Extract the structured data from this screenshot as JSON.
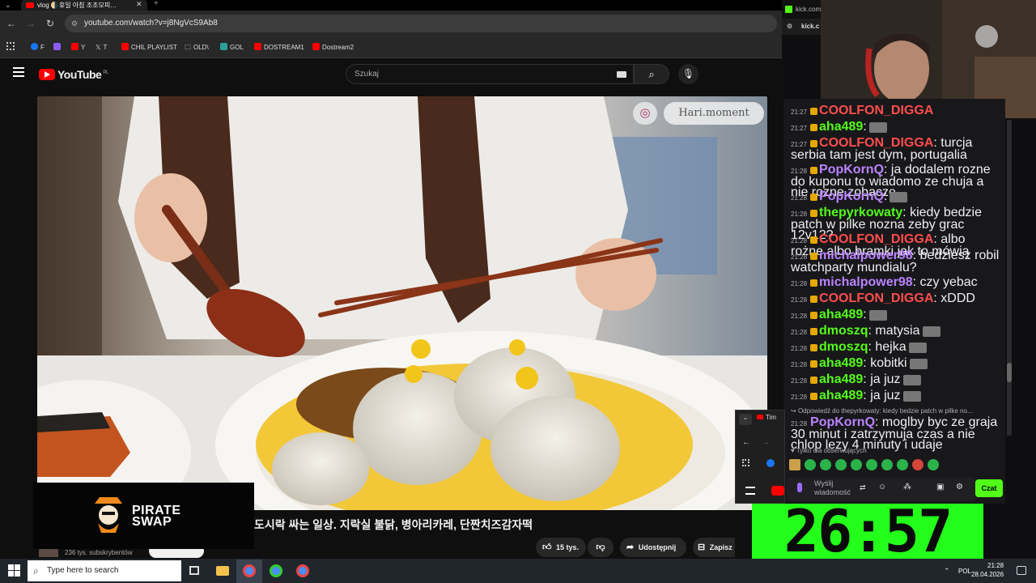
{
  "browser": {
    "tab_title": "vlog 🌗휴일 아침 조조모피…",
    "url": "youtube.com/watch?v=j8NgVcS9Ab8",
    "bookmarks": [
      {
        "label": "F",
        "color": "#1877f2"
      },
      {
        "label": "",
        "color": "#8b5cf6"
      },
      {
        "label": "Y",
        "color": "#ff0000"
      },
      {
        "label": "T",
        "color": "#ffffff"
      },
      {
        "label": "CHIL PLAYLIST",
        "color": "#ff0000"
      },
      {
        "label": "OLD\\",
        "color": "#cccccc"
      },
      {
        "label": "GOL",
        "color": "#2aa198"
      },
      {
        "label": "DOSTREAM1",
        "color": "#ff0000"
      },
      {
        "label": "Dostream2",
        "color": "#ff0000"
      }
    ]
  },
  "youtube": {
    "logo_text": "YouTube",
    "country": "PL",
    "search_placeholder": "Szukaj",
    "video_watermark": "Hari.moment",
    "video_title": "도시락 싸는 일상. 지락실 불닭, 병아리카레, 단짠치즈감자떡",
    "subscribers": "236 tys. subskrybentów",
    "likes": "15 tys.",
    "share_label": "Udostępnij",
    "save_label": "Zapisz",
    "sponsor_text_1": "PIRATE",
    "sponsor_text_2": "SWAP"
  },
  "kick": {
    "tab_title": "kick.com",
    "url": "kick.c"
  },
  "chat": {
    "messages": [
      {
        "time": "21:27",
        "user": "COOLFON_DIGGA",
        "color": "#ff4d4d",
        "text": ""
      },
      {
        "time": "21:27",
        "user": "aha489",
        "color": "#53fc18",
        "text": ":",
        "emote": true
      },
      {
        "time": "21:27",
        "user": "COOLFON_DIGGA",
        "color": "#ff4d4d",
        "text": ": turcja serbia tam jest dym, portugalia"
      },
      {
        "time": "21:28",
        "user": "PopKornQ",
        "color": "#b983ff",
        "text": ": ja dodalem rozne do kuponu to wiadomo ze chuja a nie rozne zobacze"
      },
      {
        "time": "21:28",
        "user": "PopKornQ",
        "color": "#b983ff",
        "text": ":",
        "emote": true
      },
      {
        "time": "21:28",
        "user": "thepyrkowaty",
        "color": "#53fc18",
        "text": ": kiedy bedzie patch w pilke nozna zeby grac 12v12?"
      },
      {
        "time": "21:28",
        "user": "COOLFON_DIGGA",
        "color": "#ff4d4d",
        "text": ": albo rożne albo bramki jak to mówią"
      },
      {
        "time": "21:28",
        "user": "michalpower98",
        "color": "#b983ff",
        "text": ": bedziesz robil watchparty mundialu?"
      },
      {
        "time": "21:28",
        "user": "michalpower98",
        "color": "#b983ff",
        "text": ": czy yebac"
      },
      {
        "time": "21:28",
        "user": "COOLFON_DIGGA",
        "color": "#ff4d4d",
        "text": ": xDDD"
      },
      {
        "time": "21:28",
        "user": "aha489",
        "color": "#53fc18",
        "text": ":",
        "emote": true
      },
      {
        "time": "21:28",
        "user": "dmoszq",
        "color": "#53fc18",
        "text": ": matysia",
        "emote": true
      },
      {
        "time": "21:28",
        "user": "dmoszq",
        "color": "#53fc18",
        "text": ": hejka",
        "emote": true
      },
      {
        "time": "21:28",
        "user": "aha489",
        "color": "#53fc18",
        "text": ": kobitki",
        "emote": true
      },
      {
        "time": "21:28",
        "user": "aha489",
        "color": "#53fc18",
        "text": ": ja juz",
        "emote": true
      },
      {
        "time": "21:28",
        "user": "aha489",
        "color": "#53fc18",
        "text": ": ja juz",
        "emote": true
      }
    ],
    "reply_hint": "Odpowiedź do thepyrkowaty: kiedy bedzie patch w pilke no...",
    "reply": {
      "time": "21:28",
      "user": "PopKornQ",
      "color": "#b983ff",
      "text": ": moglby byc ze graja 30 minut i zatrzymuja czas a nie chlop lezy 4 minuty i udaje"
    },
    "followers_only": "Tylko dla obserwujących",
    "input_placeholder": "Wyślij wiadomość",
    "send_button": "Czat"
  },
  "timer": "26:57",
  "mini_tab": "Tim",
  "taskbar": {
    "search_placeholder": "Type here to search",
    "lang": "POL",
    "time": "21:28",
    "date": "28.04.2026"
  }
}
